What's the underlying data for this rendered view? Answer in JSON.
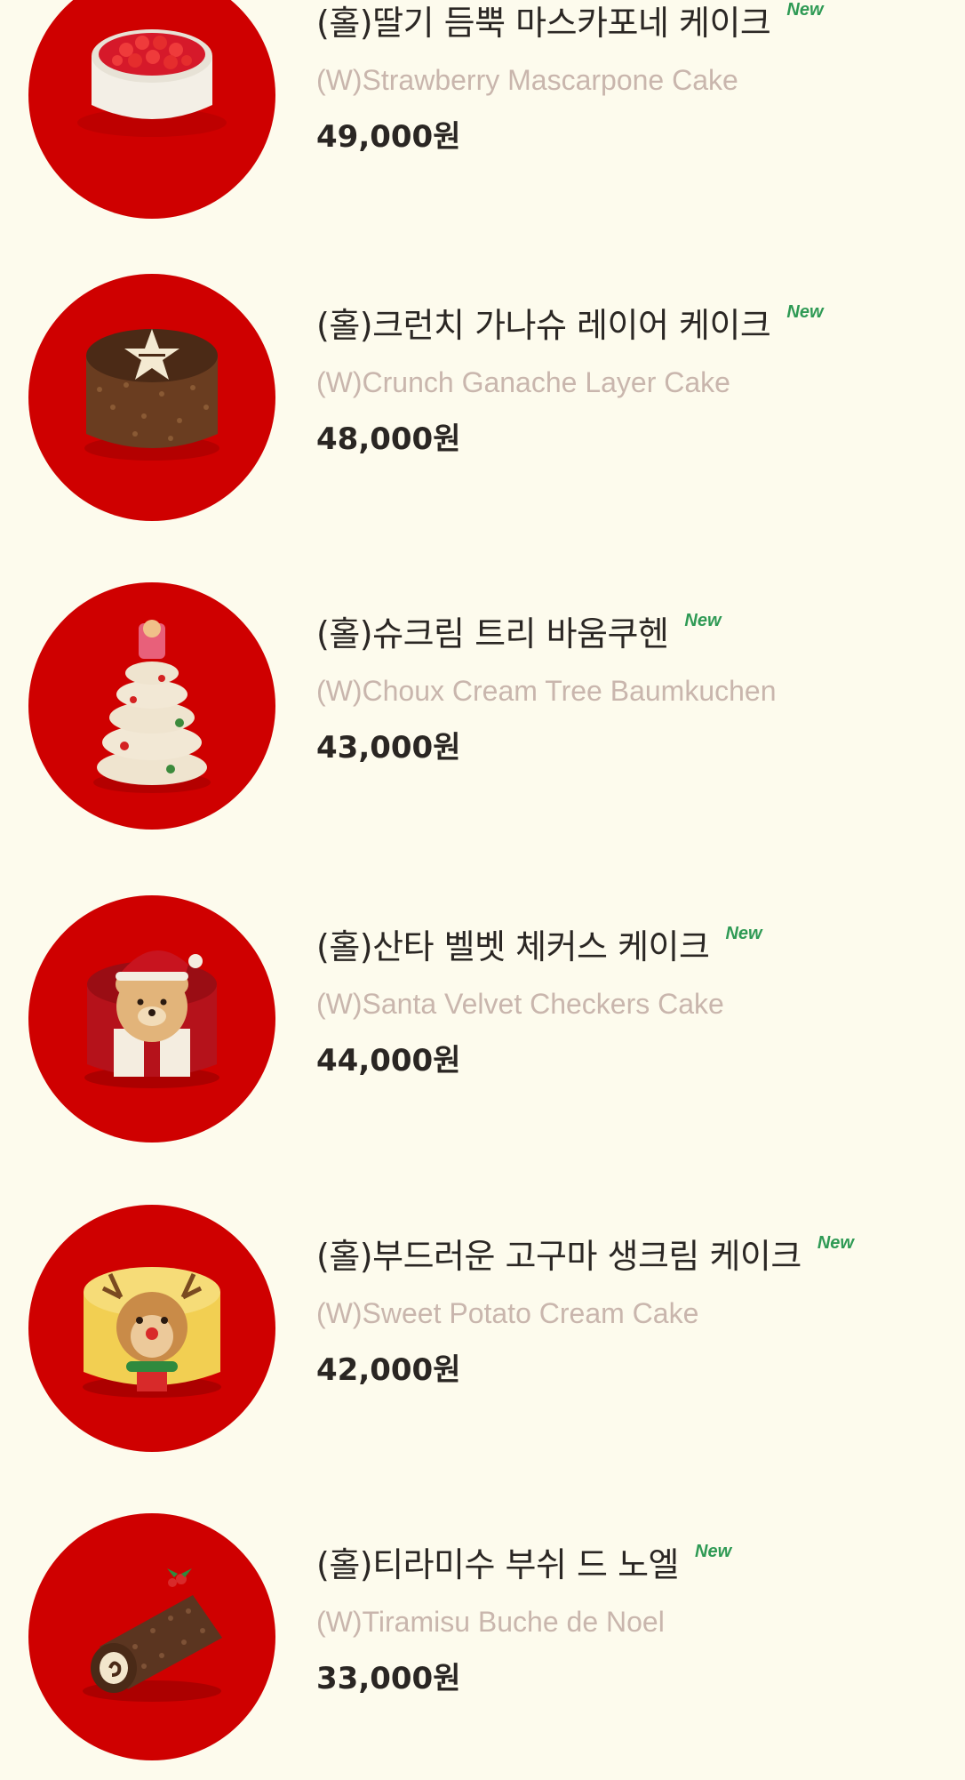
{
  "products": [
    {
      "name_ko": "(홀)딸기 듬뿍 마스카포네 케이크",
      "badge": "New",
      "name_en": "(W)Strawberry Mascarpone Cake",
      "price": "49,000원",
      "image_icon": "strawberry-mascarpone-cake-icon",
      "accent_color": "#cf0000"
    },
    {
      "name_ko": "(홀)크런치 가나슈 레이어 케이크",
      "badge": "New",
      "name_en": "(W)Crunch Ganache Layer Cake",
      "price": "48,000원",
      "image_icon": "crunch-ganache-layer-cake-icon",
      "accent_color": "#cf0000"
    },
    {
      "name_ko": "(홀)슈크림 트리 바움쿠헨",
      "badge": "New",
      "name_en": "(W)Choux Cream Tree Baumkuchen",
      "price": "43,000원",
      "image_icon": "choux-cream-tree-baumkuchen-icon",
      "accent_color": "#cf0000"
    },
    {
      "name_ko": "(홀)산타 벨벳 체커스 케이크",
      "badge": "New",
      "name_en": "(W)Santa Velvet Checkers Cake",
      "price": "44,000원",
      "image_icon": "santa-velvet-checkers-cake-icon",
      "accent_color": "#cf0000"
    },
    {
      "name_ko": "(홀)부드러운 고구마 생크림 케이크",
      "badge": "New",
      "name_en": "(W)Sweet Potato Cream Cake",
      "price": "42,000원",
      "image_icon": "sweet-potato-cream-cake-icon",
      "accent_color": "#cf0000"
    },
    {
      "name_ko": "(홀)티라미수 부쉬 드 노엘",
      "badge": "New",
      "name_en": "(W)Tiramisu Buche de Noel",
      "price": "33,000원",
      "image_icon": "tiramisu-buche-de-noel-icon",
      "accent_color": "#cf0000"
    }
  ],
  "colors": {
    "background": "#fdfbed",
    "thumb_circle": "#cf0000",
    "name_ko": "#2b2724",
    "name_en": "#c9b6ad",
    "price": "#2a2623",
    "badge": "#2f9a55"
  }
}
